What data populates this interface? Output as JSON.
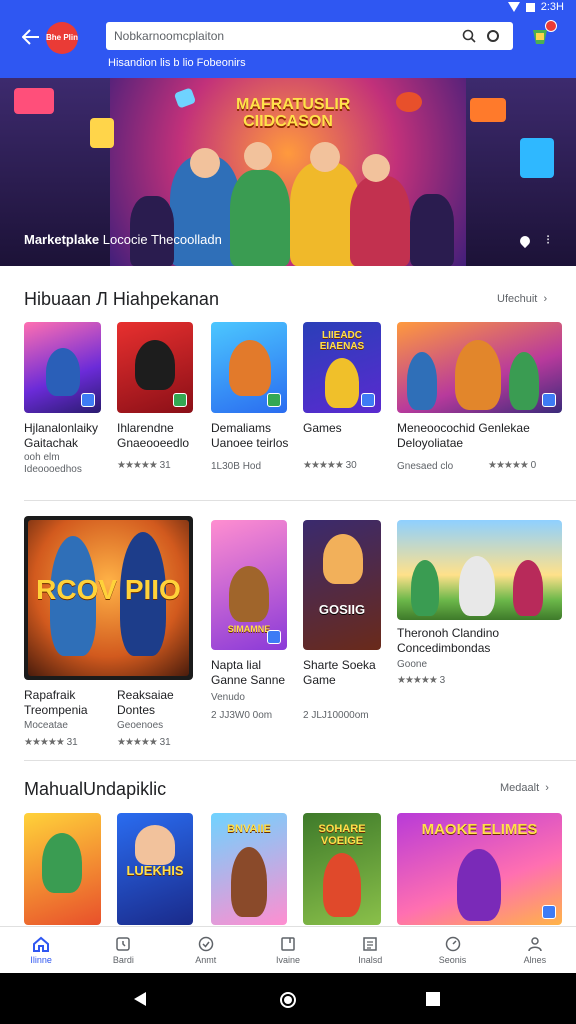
{
  "status": {
    "time": "2:3H"
  },
  "header": {
    "logo_text": "Bhe Plin",
    "search_placeholder": "Nobkarnoomcplaiton",
    "subtitle": "Hisandion lis b lio Fobeonirs"
  },
  "hero": {
    "title": "MAFRATUSLIR CIIDCASON",
    "caption_bold": "Marketplake",
    "caption_rest": "Lococie Thecoolladn",
    "more": "⁝"
  },
  "sections": [
    {
      "title": "Hibuaan Л Hiahpekanan",
      "link": "Ufechuit",
      "apps": [
        {
          "name1": "Hjlanalonlaiky",
          "name2": "Gaitachak",
          "meta": "Ideoooedhos",
          "meta2": "ooh elm",
          "rating": ""
        },
        {
          "name1": "Ihlarendne",
          "name2": "Gnaeooeedlo",
          "meta": "",
          "rating": "31"
        },
        {
          "name1": "Demaliams",
          "name2": "Uanoee teirlos",
          "meta": "1L30B Hod",
          "rating": ""
        },
        {
          "name1": "Games",
          "name2": "",
          "meta": "",
          "rating": "30"
        },
        {
          "name1": "Meneoocochid  Genlekae",
          "name2": "Deloyoliatae",
          "meta": "Gnesaed clo",
          "rating": "0"
        }
      ],
      "banner_text": "LIIEADC EIAENAS"
    },
    {
      "title": "",
      "link": "",
      "apps": [
        {
          "name1": "Rapafraik",
          "name2": "Treompenia",
          "meta": "Moceatae",
          "rating": "31"
        },
        {
          "name1": "Reaksaiae",
          "name2": "Dontes",
          "meta": "Geoenoes",
          "rating": "31"
        },
        {
          "name1": "Napta lial",
          "name2": "Ganne Sanne",
          "meta": "Venudo",
          "meta2": "2 JJ3W0 0om",
          "rating": ""
        },
        {
          "name1": "Sharte Soeka",
          "name2": "Game",
          "meta": "2 JLJ10000om",
          "rating": ""
        },
        {
          "name1": "Theronoh Clandino",
          "name2": "Concedimbondas",
          "meta": "Goone",
          "rating": "3"
        }
      ],
      "big_tile_text": "RCOV PIIO",
      "tile3_text": "SIMAMNE",
      "tile4_text": "GOSIIG"
    },
    {
      "title": "MahualUndapiklic",
      "link": "Medaalt",
      "tiles": [
        "",
        "LUEKHIS",
        "BNVAIIE",
        "SOHARE VOEIGE",
        "MAOKE ELIMES"
      ]
    }
  ],
  "bottom_nav": [
    {
      "label": "Ilinne",
      "icon": "home-icon",
      "active": true
    },
    {
      "label": "Bardi",
      "icon": "clock-icon"
    },
    {
      "label": "Anmt",
      "icon": "check-circle-icon"
    },
    {
      "label": "Ivaine",
      "icon": "bookmark-icon"
    },
    {
      "label": "Inalsd",
      "icon": "list-icon"
    },
    {
      "label": "Seonis",
      "icon": "gauge-icon"
    },
    {
      "label": "Alnes",
      "icon": "person-icon"
    }
  ],
  "colors": {
    "brand": "#2f57f2",
    "accent": "#ea3b36"
  }
}
